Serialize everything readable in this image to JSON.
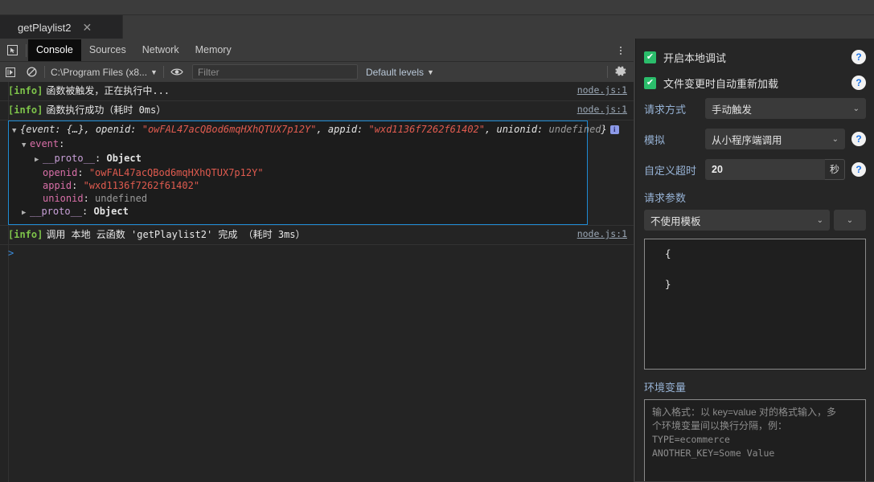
{
  "window": {
    "tab": {
      "label": "getPlaylist2",
      "close_icon": "close-icon"
    }
  },
  "devtools": {
    "tabs": [
      {
        "label": "Console",
        "active": true
      },
      {
        "label": "Sources",
        "active": false
      },
      {
        "label": "Network",
        "active": false
      },
      {
        "label": "Memory",
        "active": false
      }
    ],
    "inspect_icon": "inspect-element-icon",
    "kebab_icon": "more-options-icon",
    "toolbar": {
      "execute_icon": "execute-icon",
      "clear_icon": "clear-console-icon",
      "context": "C:\\Program Files (x8...",
      "context_caret": "▼",
      "eye_icon": "live-expression-icon",
      "filter_placeholder": "Filter",
      "levels": "Default levels",
      "levels_caret": "▼",
      "gear_icon": "console-settings-icon"
    },
    "logs": [
      {
        "tag": "[info]",
        "message": "函数被触发，正在执行中...",
        "source": "node.js:1"
      },
      {
        "tag": "[info]",
        "message": "函数执行成功（耗时 0ms）",
        "source": "node.js:1"
      }
    ],
    "object_preview": {
      "arrow": "▼",
      "head_prefix": "{event: ",
      "head_event": "{…}",
      "head_mid": ", openid: ",
      "head_openid": "\"owFAL47acQBod6mqHXhQTUX7p12Y\"",
      "head_mid2": ", appid: ",
      "head_appid": "\"wxd1136f7262f61402\"",
      "head_mid3": ", unionid: ",
      "head_unionid": "undefined",
      "head_suffix": "}",
      "badge": "i",
      "lines": [
        {
          "indent": 1,
          "arrow": "▼",
          "key": "event",
          "sep": ":",
          "value": "",
          "value_type": "none"
        },
        {
          "indent": 2,
          "arrow": "▶",
          "key": "__proto__",
          "sep": ": ",
          "value": "Object",
          "value_type": "object"
        },
        {
          "indent": 2,
          "arrow": "",
          "key": "openid",
          "sep": ": ",
          "value": "\"owFAL47acQBod6mqHXhQTUX7p12Y\"",
          "value_type": "string"
        },
        {
          "indent": 2,
          "arrow": "",
          "key": "appid",
          "sep": ": ",
          "value": "\"wxd1136f7262f61402\"",
          "value_type": "string"
        },
        {
          "indent": 2,
          "arrow": "",
          "key": "unionid",
          "sep": ": ",
          "value": "undefined",
          "value_type": "undefined"
        },
        {
          "indent": 1,
          "arrow": "▶",
          "key": "__proto__",
          "sep": ": ",
          "value": "Object",
          "value_type": "object"
        }
      ]
    },
    "final_log": {
      "tag": "[info]",
      "message": "调用 本地 云函数 'getPlaylist2' 完成 （耗时 3ms）",
      "source": "node.js:1"
    },
    "prompt": ">"
  },
  "panel": {
    "checkboxes": [
      {
        "label": "开启本地调试",
        "checked": true,
        "check_glyph": "✔",
        "help": "?"
      },
      {
        "label": "文件变更时自动重新加载",
        "checked": true,
        "check_glyph": "✔",
        "help": "?"
      }
    ],
    "request_method": {
      "label": "请求方式",
      "value": "手动触发",
      "caret": "⌄"
    },
    "simulate": {
      "label": "模拟",
      "value": "从小程序端调用",
      "caret": "⌄",
      "help": "?"
    },
    "timeout": {
      "label": "自定义超时",
      "value": "20",
      "unit": "秒",
      "help": "?"
    },
    "request_params": {
      "label": "请求参数",
      "template_value": "不使用模板",
      "caret": "⌄",
      "extra_caret": "⌄",
      "json_text": "  {\n\n  }"
    },
    "env": {
      "label": "环境变量",
      "placeholder_line1": "输入格式：以 key=value 对的格式输入，多",
      "placeholder_line2": "个环境变量间以换行分隔，例：",
      "placeholder_line3": "TYPE=ecommerce",
      "placeholder_line4": "ANOTHER_KEY=Some Value"
    }
  },
  "colors": {
    "accent_blue": "#1e8bd4",
    "info_green": "#7ec44a",
    "string_red": "#e05b4f",
    "prop_pink": "#d96fa8",
    "check_green": "#2bbd6b",
    "label_blue": "#97b3d6"
  }
}
